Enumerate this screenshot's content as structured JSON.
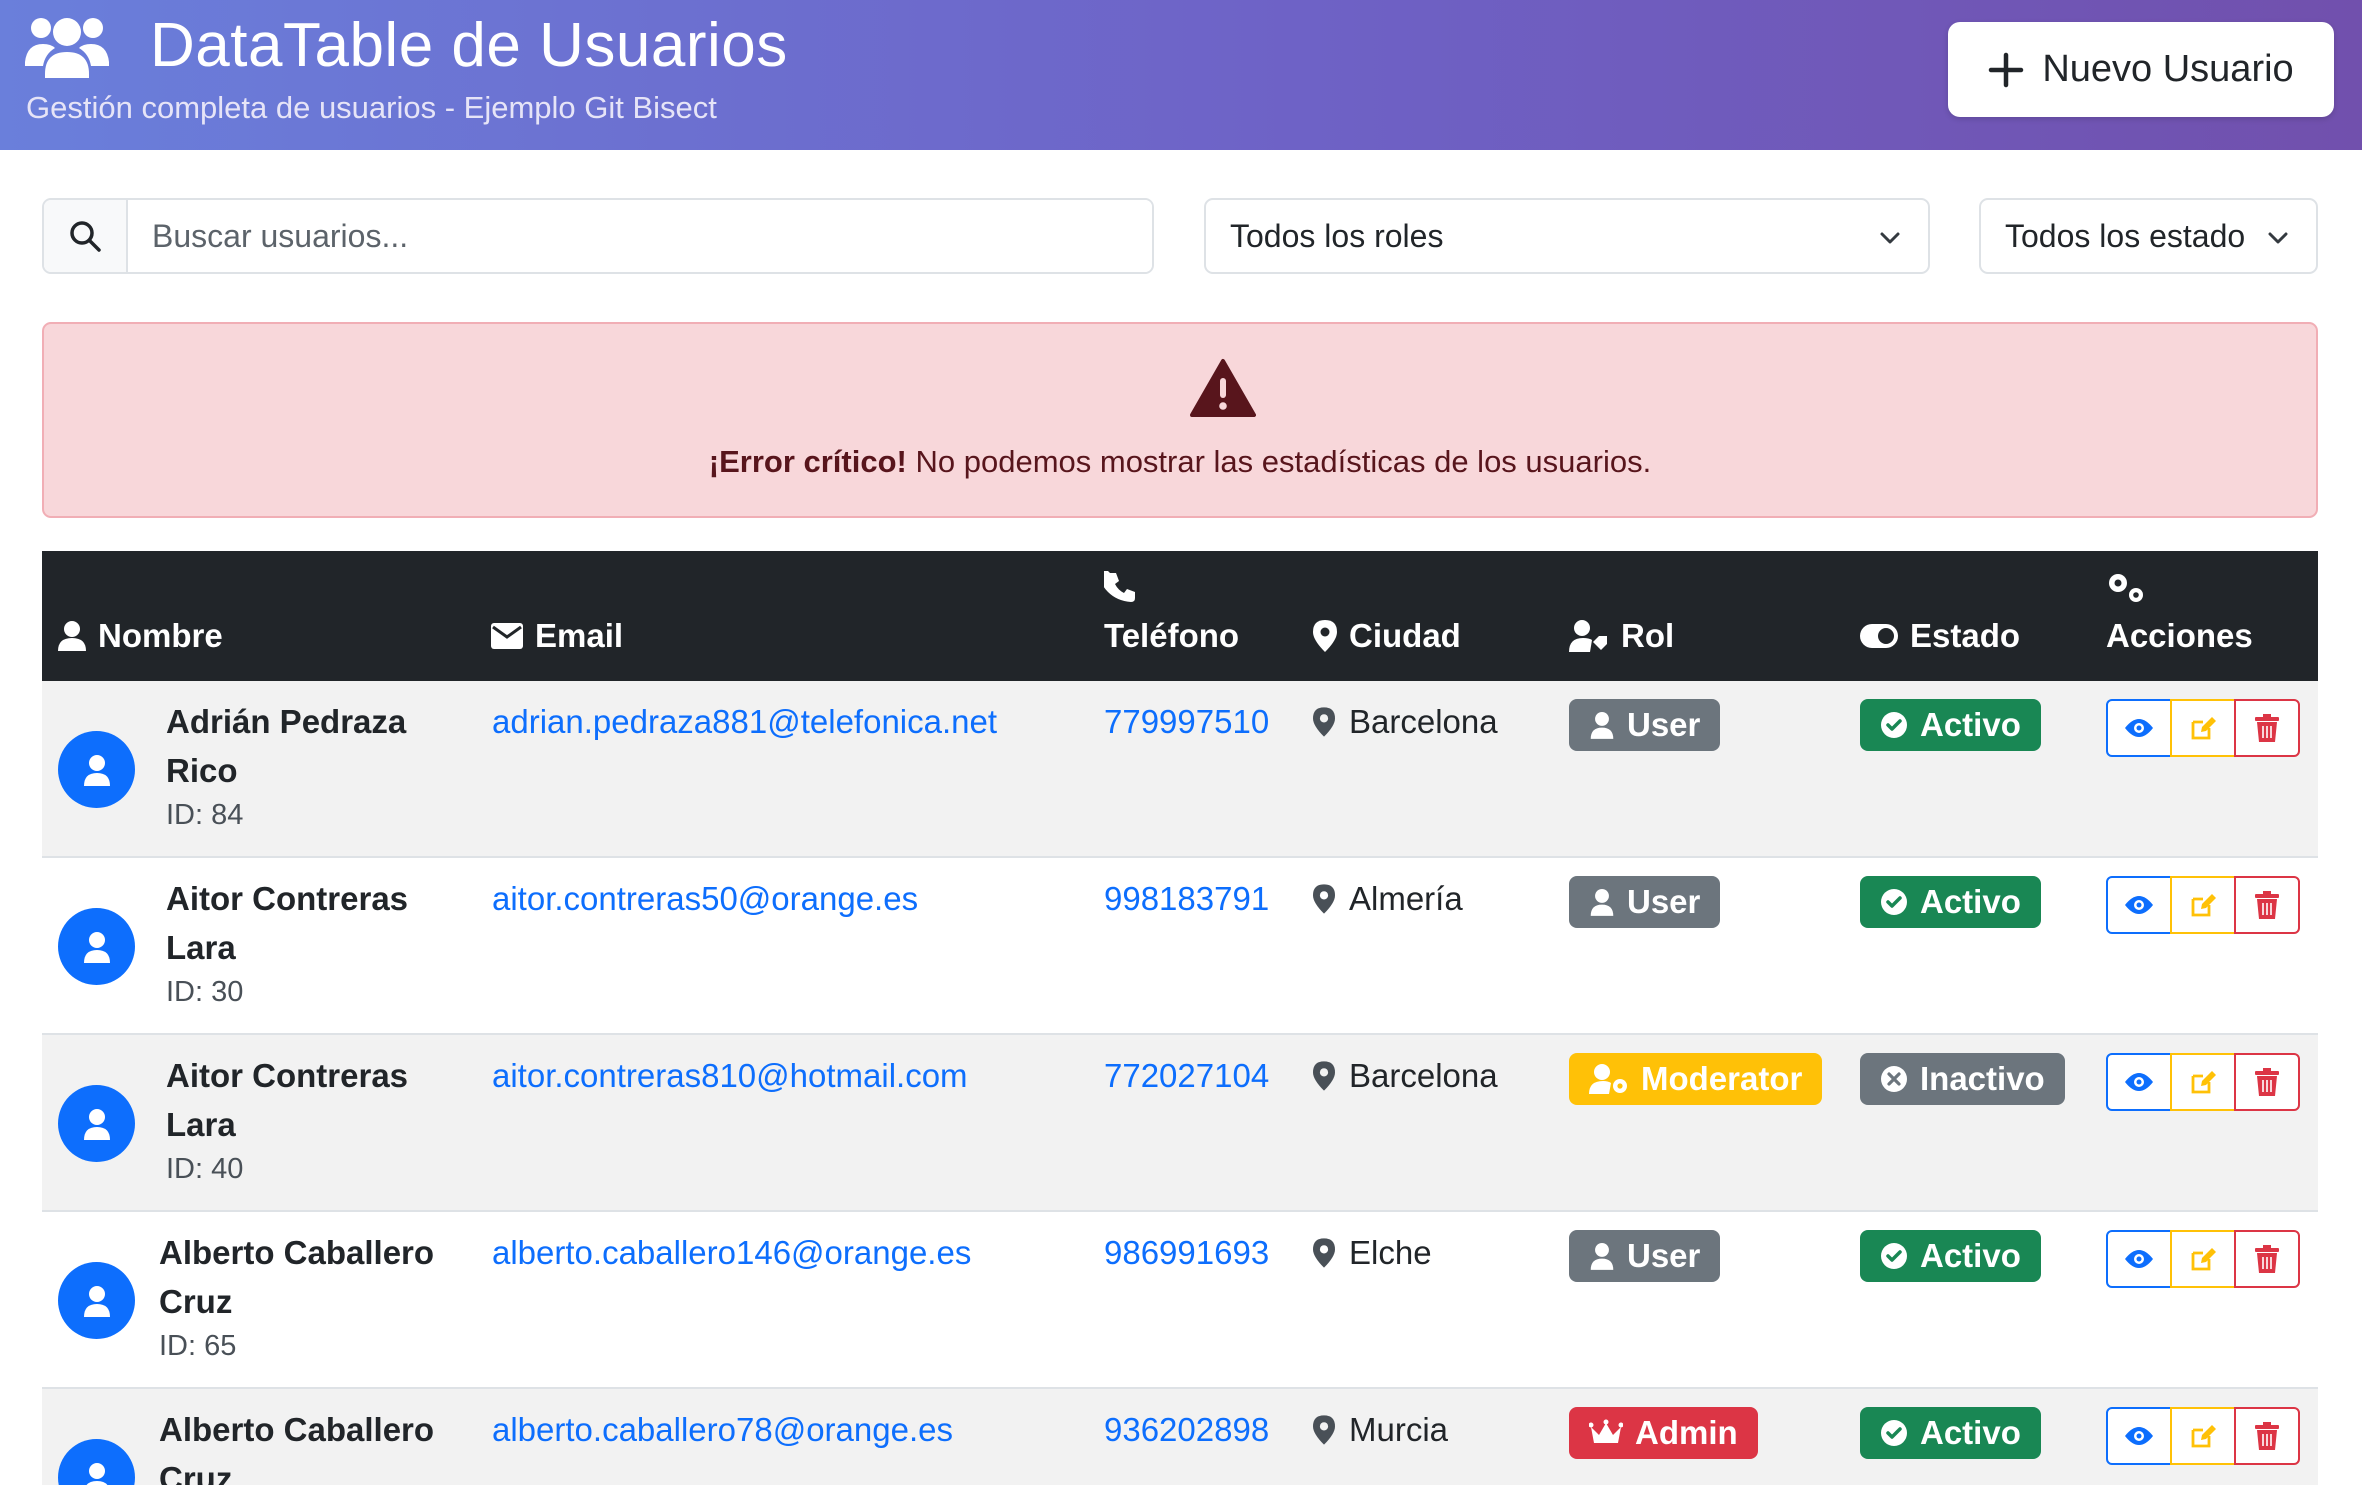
{
  "header": {
    "title": "DataTable de Usuarios",
    "subtitle": "Gestión completa de usuarios - Ejemplo Git Bisect",
    "new_button": "Nuevo Usuario",
    "icons": {
      "title": "users-icon",
      "new": "plus-icon"
    }
  },
  "filters": {
    "search_placeholder": "Buscar usuarios...",
    "roles_value": "Todos los roles",
    "estados_value": "Todos los estados"
  },
  "alert": {
    "strong": "¡Error crítico!",
    "message": " No podemos mostrar las estadísticas de los usuarios."
  },
  "table": {
    "headers": {
      "nombre": "Nombre",
      "email": "Email",
      "telefono": "Teléfono",
      "ciudad": "Ciudad",
      "rol": "Rol",
      "estado": "Estado",
      "acciones": "Acciones"
    },
    "rows": [
      {
        "name": "Adrián Pedraza Rico",
        "id": "ID: 84",
        "email": "adrian.pedraza881@telefonica.net",
        "phone": "779997510",
        "city": "Barcelona",
        "role": "User",
        "status": "Activo"
      },
      {
        "name": "Aitor Contreras Lara",
        "id": "ID: 30",
        "email": "aitor.contreras50@orange.es",
        "phone": "998183791",
        "city": "Almería",
        "role": "User",
        "status": "Activo"
      },
      {
        "name": "Aitor Contreras Lara",
        "id": "ID: 40",
        "email": "aitor.contreras810@hotmail.com",
        "phone": "772027104",
        "city": "Barcelona",
        "role": "Moderator",
        "status": "Inactivo"
      },
      {
        "name": "Alberto Caballero Cruz",
        "id": "ID: 65",
        "email": "alberto.caballero146@orange.es",
        "phone": "986991693",
        "city": "Elche",
        "role": "User",
        "status": "Activo"
      },
      {
        "name": "Alberto Caballero Cruz",
        "id": "",
        "email": "alberto.caballero78@orange.es",
        "phone": "936202898",
        "city": "Murcia",
        "role": "Admin",
        "status": "Activo"
      }
    ]
  },
  "colors": {
    "header_gradient_start": "#6a7fdb",
    "header_gradient_end": "#7150ad",
    "primary": "#0d6efd",
    "role_user": "#6c757d",
    "role_moderator": "#ffc107",
    "role_admin": "#dc3545",
    "status_active": "#198754",
    "status_inactive": "#6c757d",
    "alert_bg": "#f8d7da"
  }
}
